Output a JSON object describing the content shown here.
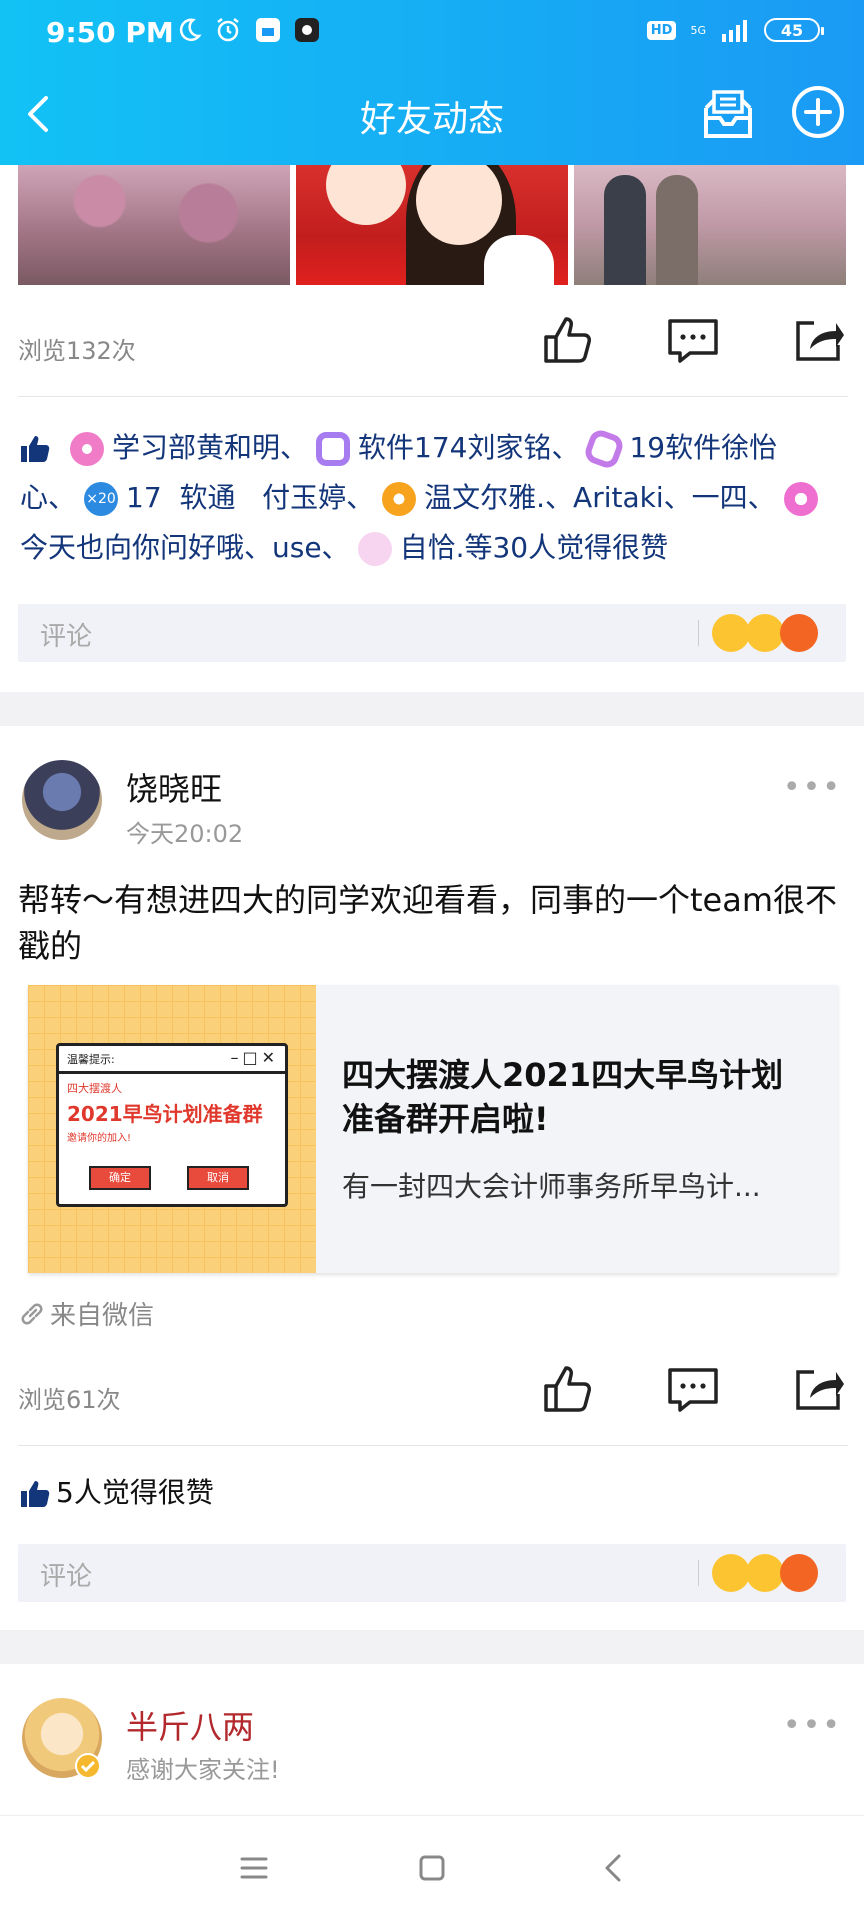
{
  "status_bar": {
    "time": "9:50 PM",
    "network": "5G",
    "battery": "45"
  },
  "header": {
    "title": "好友动态"
  },
  "post1": {
    "views": "浏览132次",
    "likes_line1": [
      "学习部黄和明、",
      "软件174刘家铭、",
      "19软件徐怡"
    ],
    "likes_line2": [
      "心、",
      "17  软通   付玉婷、",
      "温文尔雅.、Aritaki、一四、"
    ],
    "likes_line3": [
      "今天也向你问好哦、use、",
      "自恰.等30人觉得很赞"
    ],
    "comment_placeholder": "评论"
  },
  "post2": {
    "author": "饶晓旺",
    "time": "今天20:02",
    "text": "帮转～有想进四大的同学欢迎看看，同事的一个team很不戳的",
    "share_title": "四大摆渡人2021四大早鸟计划准备群开启啦!",
    "share_desc": "有一封四大会计师事务所早鸟计...",
    "share_img_tip": "温馨提示:",
    "share_img_line1": "四大摆渡人",
    "share_img_line2": "2021早鸟计划准备群",
    "share_img_line3": "邀请你的加入!",
    "share_img_ok": "确定",
    "share_img_cancel": "取消",
    "source": "来自微信",
    "views": "浏览61次",
    "likes": "5人觉得很赞",
    "comment_placeholder": "评论"
  },
  "post3": {
    "author": "半斤八两",
    "subtitle": "感谢大家关注!"
  },
  "colors": {
    "header_start": "#12c2f5",
    "header_end": "#1a9af4",
    "like_text": "#13357a",
    "author3": "#b3282d"
  }
}
